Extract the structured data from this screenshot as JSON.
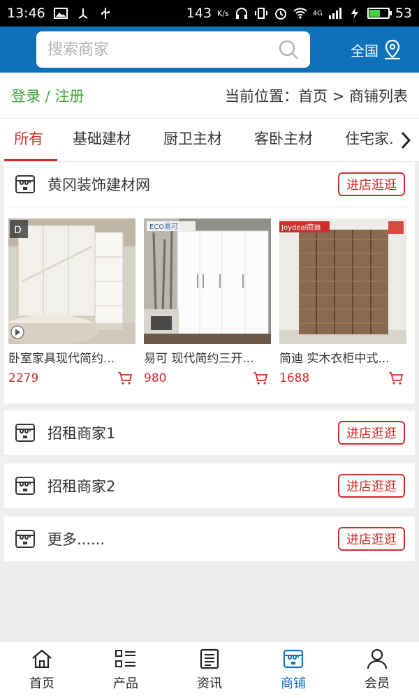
{
  "status": {
    "time": "13:46",
    "net_speed": "143",
    "net_unit": "K/s",
    "signal": "4G",
    "battery": "53",
    "battery_level": 0.53
  },
  "search": {
    "placeholder": "搜索商家"
  },
  "region": {
    "label": "全国"
  },
  "auth": {
    "login_label": "登录 / 注册"
  },
  "breadcrumb": {
    "text": "当前位置：首页 > 商铺列表"
  },
  "tabs": [
    "所有",
    "基础建材",
    "厨卫主材",
    "客卧主材",
    "住宅家..."
  ],
  "shops": [
    {
      "name": "黄冈装饰建材网",
      "visit_label": "进店逛逛",
      "products": [
        {
          "title": "卧室家具现代简约...",
          "price": "2279"
        },
        {
          "title": "易可 现代简约三开...",
          "price": "980"
        },
        {
          "title": "简迪 实木衣柜中式...",
          "price": "1688"
        }
      ]
    },
    {
      "name": "招租商家1",
      "visit_label": "进店逛逛"
    },
    {
      "name": "招租商家2",
      "visit_label": "进店逛逛"
    },
    {
      "name": "更多......",
      "visit_label": "进店逛逛"
    }
  ],
  "brands": {
    "p2": "ECO易可",
    "p3": "Joydeal简迪"
  },
  "nav": [
    {
      "label": "首页",
      "icon": "home-icon"
    },
    {
      "label": "产品",
      "icon": "list-icon"
    },
    {
      "label": "资讯",
      "icon": "news-icon"
    },
    {
      "label": "商铺",
      "icon": "shop-icon"
    },
    {
      "label": "会员",
      "icon": "user-icon"
    }
  ],
  "colors": {
    "primary": "#0e71b9",
    "accent_red": "#c9302c",
    "login_green": "#41a53d"
  }
}
